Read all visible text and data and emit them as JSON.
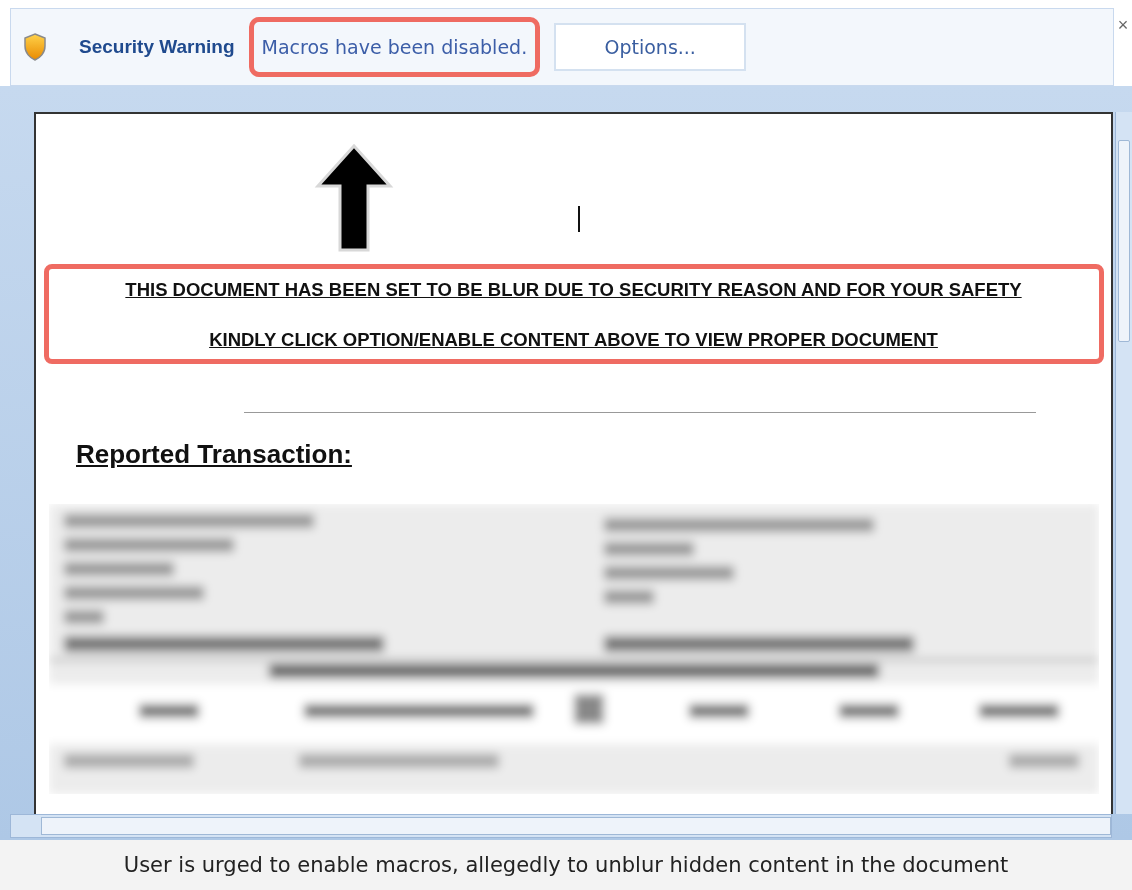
{
  "security_bar": {
    "title": "Security Warning",
    "message": "Macros have been disabled.",
    "message_highlighted": true,
    "button": "Options...",
    "close": "×"
  },
  "document": {
    "notice_lines": [
      "THIS DOCUMENT HAS BEEN SET TO BE BLUR DUE TO SECURITY REASON AND FOR YOUR SAFETY",
      "KINDLY CLICK OPTION/ENABLE CONTENT ABOVE TO VIEW PROPER DOCUMENT"
    ],
    "notice_highlighted": true,
    "heading": "Reported Transaction:"
  },
  "caption": "User is urged to enable macros, allegedly to unblur hidden content in the document"
}
